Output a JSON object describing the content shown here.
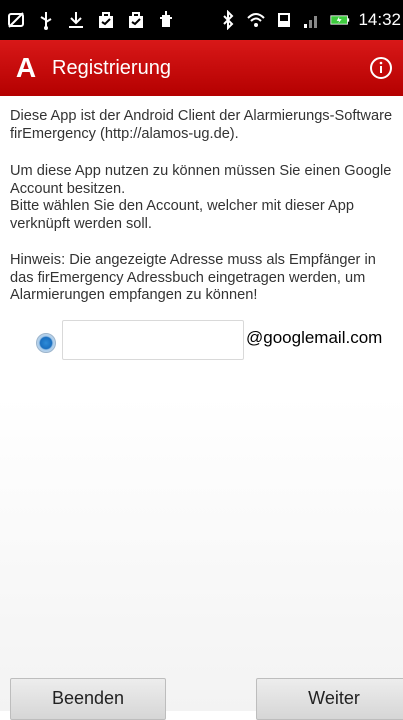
{
  "statusbar": {
    "time": "14:32",
    "icons_left": [
      "sync-off-icon",
      "usb-icon",
      "download-icon",
      "bag-icon",
      "bag-icon-2",
      "app-icon"
    ],
    "icons_right": [
      "bluetooth-off-icon",
      "wifi-icon",
      "sd-card-icon",
      "signal-icon",
      "battery-charging-icon"
    ]
  },
  "actionbar": {
    "logo": "A",
    "title": "Registrierung",
    "accent": "#c40000"
  },
  "content": {
    "paragraph1": "Diese App ist der Android Client der Alarmierungs-Software firEmergency (http://alamos-ug.de).",
    "paragraph2": "Um diese App nutzen zu können müssen Sie einen Google Account besitzen.\nBitte wählen Sie den Account, welcher mit dieser App verknüpft werden soll.",
    "paragraph3": "Hinweis: Die angezeigte Adresse muss als Empfänger in das firEmergency Adressbuch eingetragen werden, um Alarmierungen empfangen zu können!",
    "email_value": "",
    "email_placeholder": "",
    "domain": "@googlemail.com"
  },
  "buttons": {
    "exit_label": "Beenden",
    "next_label": "Weiter"
  }
}
